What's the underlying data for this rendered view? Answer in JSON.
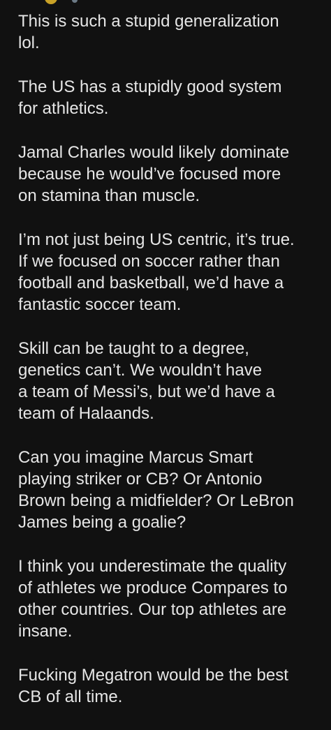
{
  "colors": {
    "background": "#111111",
    "text": "#e6e6e6",
    "avatar": "#c9a227"
  },
  "header": {
    "avatar_icon": "avatar-icon",
    "indicator_icon": "dot-icon"
  },
  "comment": {
    "paragraphs": [
      "This is such a stupid generalization\nlol.",
      "The US has a stupidly good system\nfor athletics.",
      "Jamal Charles would likely dominate\nbecause he would’ve focused more\non stamina than muscle.",
      "I’m not just being US centric, it’s true.\nIf we focused on soccer rather than\nfootball and basketball, we’d have a\nfantastic soccer team.",
      "Skill can be taught to a degree,\ngenetics can’t. We wouldn’t have\na team of Messi’s, but we’d have a\nteam of Halaands.",
      "Can you imagine Marcus Smart\nplaying striker or CB? Or Antonio\nBrown being a midfielder? Or LeBron\nJames being a goalie?",
      "I think you underestimate the quality\nof athletes we produce Compares to\nother countries. Our top athletes are\ninsane.",
      "Fucking Megatron would be the best\nCB of all time."
    ]
  }
}
